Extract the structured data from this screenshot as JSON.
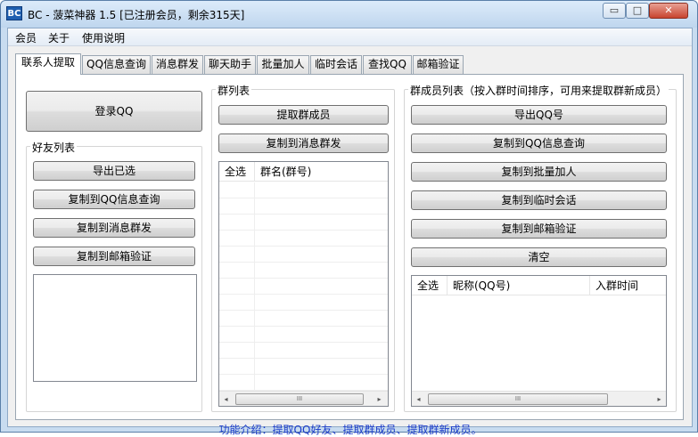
{
  "window": {
    "icon_text": "BC",
    "title": "BC - 菠菜神器 1.5  [已注册会员，剩余315天]",
    "min_glyph": "▭",
    "max_glyph": "□",
    "close_glyph": "✕"
  },
  "menu": [
    "会员",
    "关于",
    "使用说明"
  ],
  "tabs": [
    "联系人提取",
    "QQ信息查询",
    "消息群发",
    "聊天助手",
    "批量加人",
    "临时会话",
    "查找QQ",
    "邮箱验证"
  ],
  "left": {
    "login_button": "登录QQ",
    "friends_title": "好友列表",
    "buttons": [
      "导出已选",
      "复制到QQ信息查询",
      "复制到消息群发",
      "复制到邮箱验证"
    ]
  },
  "groups": {
    "title": "群列表",
    "buttons": [
      "提取群成员",
      "复制到消息群发"
    ],
    "columns": [
      "全选",
      "群名(群号)"
    ]
  },
  "members": {
    "title": "群成员列表（按入群时间排序，可用来提取群新成员）",
    "buttons": [
      "导出QQ号",
      "复制到QQ信息查询",
      "复制到批量加人",
      "复制到临时会话",
      "复制到邮箱验证",
      "清空"
    ],
    "columns": [
      "全选",
      "昵称(QQ号)",
      "入群时间"
    ]
  },
  "scroll": {
    "left_arrow": "◂",
    "right_arrow": "▸",
    "thumb_grip": "III"
  },
  "footer": "功能介绍：提取QQ好友、提取群成员、提取群新成员。",
  "colors": {
    "footer_text": "#1a3bc9",
    "title_bar": "#c8dcf0",
    "close_button": "#c8442f"
  }
}
